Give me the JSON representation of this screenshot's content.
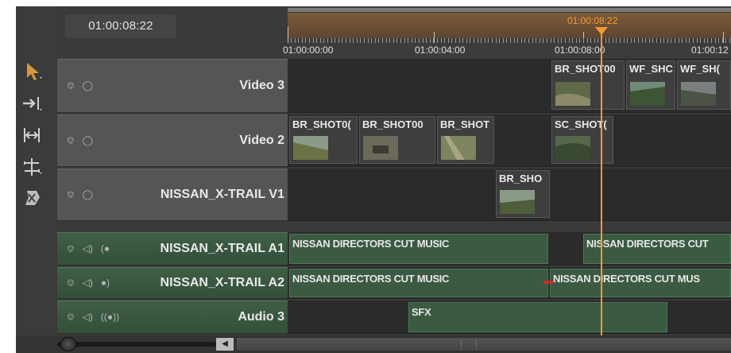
{
  "timecode": "01:00:08:22",
  "ruler": {
    "playhead": "01:00:08:22",
    "labels": [
      "01:00:00:00",
      "01:00:04:00",
      "01:00:08:00",
      "01:00:12"
    ]
  },
  "tracks": {
    "video3": {
      "name": "Video 3",
      "icons": [
        "lock-icon",
        "eye-icon"
      ],
      "clips": [
        {
          "label": "BR_SHOT00"
        },
        {
          "label": "WF_SHC"
        },
        {
          "label": "WF_SH("
        }
      ]
    },
    "video2": {
      "name": "Video 2",
      "icons": [
        "lock-icon",
        "eye-icon"
      ],
      "clips": [
        {
          "label": "BR_SHOT0("
        },
        {
          "label": "BR_SHOT00"
        },
        {
          "label": "BR_SHOT"
        },
        {
          "label": "SC_SHOT("
        }
      ]
    },
    "v1": {
      "name": "NISSAN_X-TRAIL V1",
      "icons": [
        "lock-icon",
        "eye-icon"
      ],
      "clips": [
        {
          "label": "BR_SHO"
        }
      ]
    },
    "a1": {
      "name": "NISSAN_X-TRAIL A1",
      "icons": [
        "lock-icon",
        "speaker-icon",
        "stereo-left-icon"
      ],
      "clips": [
        {
          "label": "NISSAN DIRECTORS CUT MUSIC"
        },
        {
          "label": "NISSAN DIRECTORS CUT"
        }
      ]
    },
    "a2": {
      "name": "NISSAN_X-TRAIL A2",
      "icons": [
        "lock-icon",
        "speaker-icon",
        "stereo-right-icon"
      ],
      "clips": [
        {
          "label": "NISSAN DIRECTORS CUT MUSIC"
        },
        {
          "label": "NISSAN DIRECTORS CUT MUS"
        }
      ]
    },
    "a3": {
      "name": "Audio 3",
      "icons": [
        "lock-icon",
        "speaker-icon",
        "stereo-icon"
      ],
      "clips": [
        {
          "label": "SFX"
        }
      ]
    }
  },
  "colors": {
    "playhead": "#f29a34",
    "audio_clip": "#3a5a41",
    "in_out_range": "#6e5038"
  },
  "tools": [
    "selection-tool-icon",
    "track-select-icon",
    "ripple-edit-icon",
    "rolling-edit-icon",
    "razor-tool-icon"
  ]
}
